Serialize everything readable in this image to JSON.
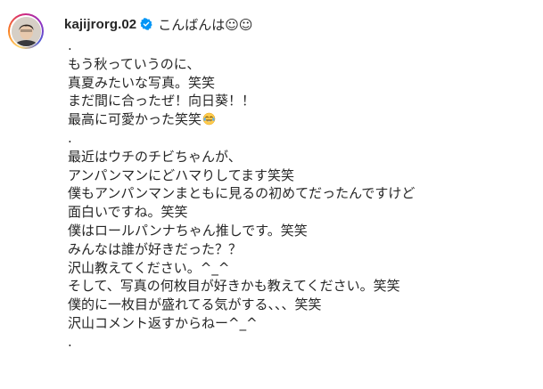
{
  "post": {
    "username": "kajijrorg.02",
    "verified": true,
    "first_line": "こんばんは☺︎☺︎",
    "caption_lines": [
      ".",
      "もう秋っていうのに、",
      "真夏みたいな写真。笑笑",
      "まだ間に合ったぜ！向日葵！！",
      "最高に可愛かった笑笑",
      ".",
      "最近はウチのチビちゃんが、",
      "アンパンマンにどハマりしてます笑笑",
      "僕もアンパンマンまともに見るの初めてだったんですけど",
      "面白いですね。笑笑",
      "僕はロールパンナちゃん推しです。笑笑",
      "みんなは誰が好きだった？？",
      "沢山教えてください。^_^",
      "そして、写真の何枚目が好きかも教えてください。笑笑",
      "僕的に一枚目が盛れてる気がする、、、笑笑",
      "沢山コメント返すからねー^_^",
      "."
    ],
    "emoji_after_line_index": 4,
    "emoji_name": "tears-of-joy-emoji"
  },
  "colors": {
    "text": "#262626",
    "verified_badge": "#0095f6",
    "background": "#ffffff"
  }
}
